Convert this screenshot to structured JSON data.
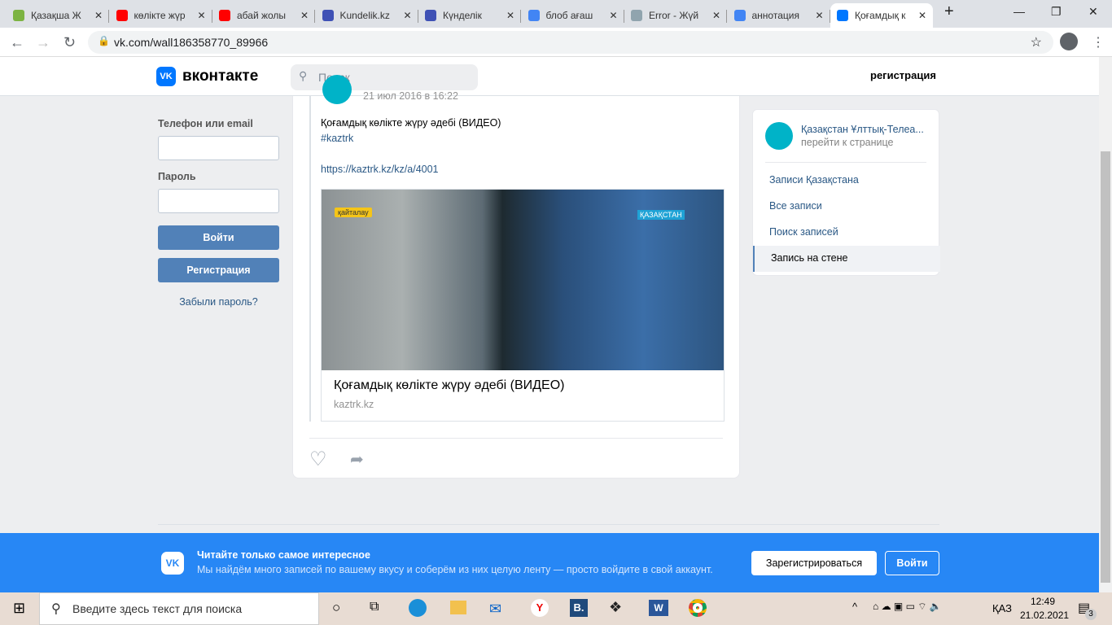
{
  "browser": {
    "tabs": [
      {
        "label": "Қазақша Ж",
        "icon": "z-icon",
        "color": "#7cb342"
      },
      {
        "label": "көлікте жүр",
        "icon": "youtube-icon",
        "color": "#ff0000"
      },
      {
        "label": "абай жолы",
        "icon": "youtube-icon",
        "color": "#ff0000"
      },
      {
        "label": "Kundelik.kz",
        "icon": "kundelik-icon",
        "color": "#3f51b5"
      },
      {
        "label": "Күнделік",
        "icon": "kundelik-icon",
        "color": "#3f51b5"
      },
      {
        "label": "блоб ағаш",
        "icon": "google-icon",
        "color": "#4285f4"
      },
      {
        "label": "Error - Жүй",
        "icon": "doc-icon",
        "color": "#90a4ae"
      },
      {
        "label": "аннотация",
        "icon": "google-icon",
        "color": "#4285f4"
      },
      {
        "label": "Қоғамдық к",
        "icon": "vk-icon",
        "color": "#0077ff"
      }
    ],
    "url": "vk.com/wall186358770_89966"
  },
  "header": {
    "logo": "вконтакте",
    "search_placeholder": "Поиск",
    "register": "регистрация"
  },
  "login": {
    "phone_label": "Телефон или email",
    "password_label": "Пароль",
    "login_button": "Войти",
    "register_button": "Регистрация",
    "forgot": "Забыли пароль?"
  },
  "post": {
    "date": "21 июл 2016 в 16:22",
    "text": "Қоғамдық көлікте жүру әдебі (ВИДЕО)",
    "hashtag": "#kaztrk",
    "link": "https://kaztrk.kz/kz/a/4001",
    "media_title": "Қоғамдық көлікте жүру әдебі (ВИДЕО)",
    "media_domain": "kaztrk.kz",
    "badge_replay": "қайталау",
    "badge_channel": "ҚАЗАҚСТАН"
  },
  "sidebar": {
    "group_name": "Қазақстан Ұлттық-Телеа...",
    "group_sub": "перейти к странице",
    "items": [
      "Записи Қазақстана",
      "Все записи",
      "Поиск записей",
      "Запись на стене"
    ]
  },
  "banner": {
    "title": "Читайте только самое интересное",
    "text": "Мы найдём много записей по вашему вкусу и соберём из них целую ленту — просто войдите в свой аккаунт.",
    "register": "Зарегистрироваться",
    "login": "Войти"
  },
  "taskbar": {
    "search_placeholder": "Введите здесь текст для поиска",
    "lang": "ҚАЗ",
    "time": "12:49",
    "date": "21.02.2021",
    "notifications": "3"
  }
}
